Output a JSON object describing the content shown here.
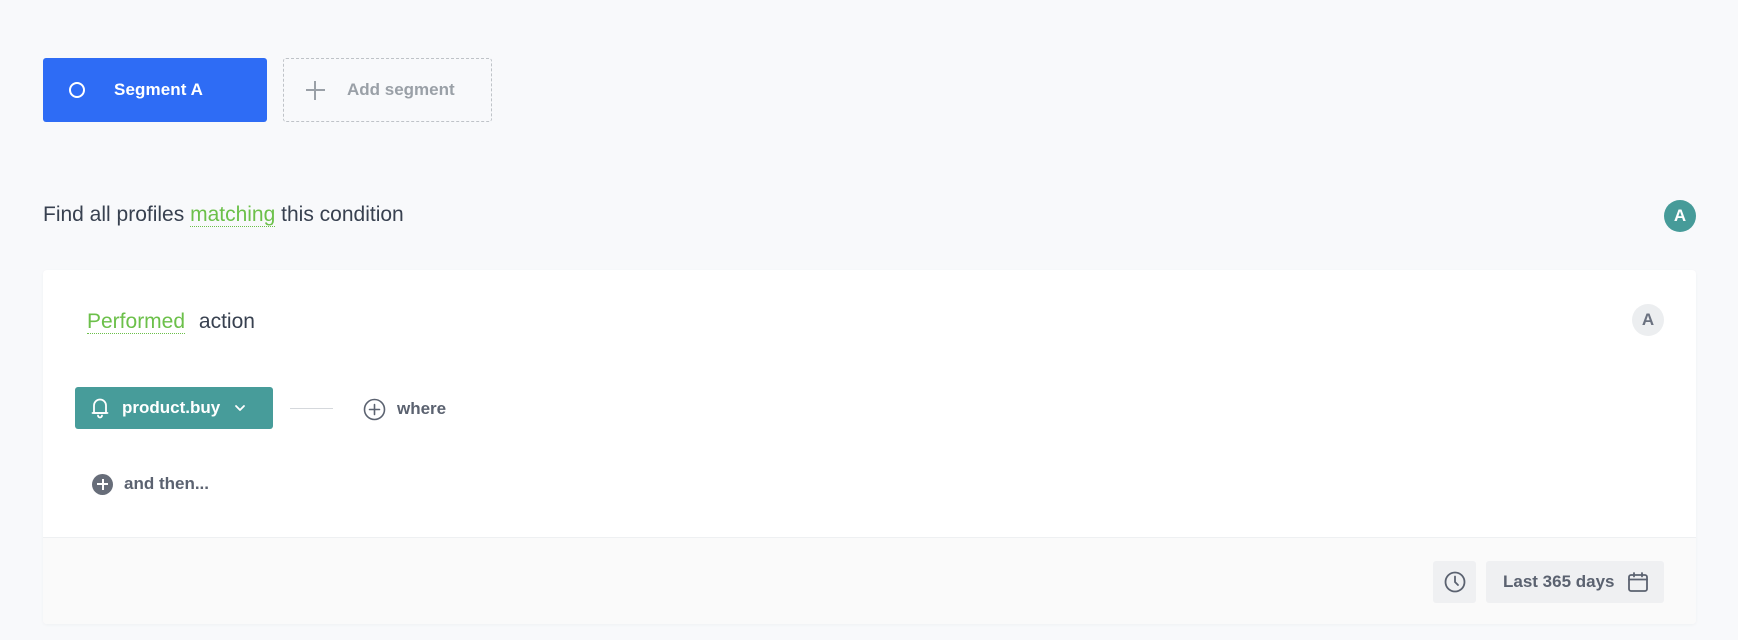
{
  "segments": {
    "active": {
      "label": "Segment A",
      "icon": "circle-outline-icon"
    },
    "add": {
      "label": "Add segment",
      "icon": "plus-icon"
    }
  },
  "condition": {
    "prefix": "Find all profiles",
    "mode": "matching",
    "suffix": "this condition",
    "badge": "A"
  },
  "step": {
    "verb": "Performed",
    "noun": "action",
    "badge": "A",
    "event": {
      "label": "product.buy",
      "icon": "bell-icon"
    },
    "where_label": "where",
    "and_then_label": "and then..."
  },
  "footer": {
    "date_range": "Last 365 days",
    "clock_icon": "clock-icon",
    "calendar_icon": "calendar-icon"
  },
  "colors": {
    "primary": "#2e6cf5",
    "accent_green": "#6cc04a",
    "event_teal": "#479c9a"
  }
}
